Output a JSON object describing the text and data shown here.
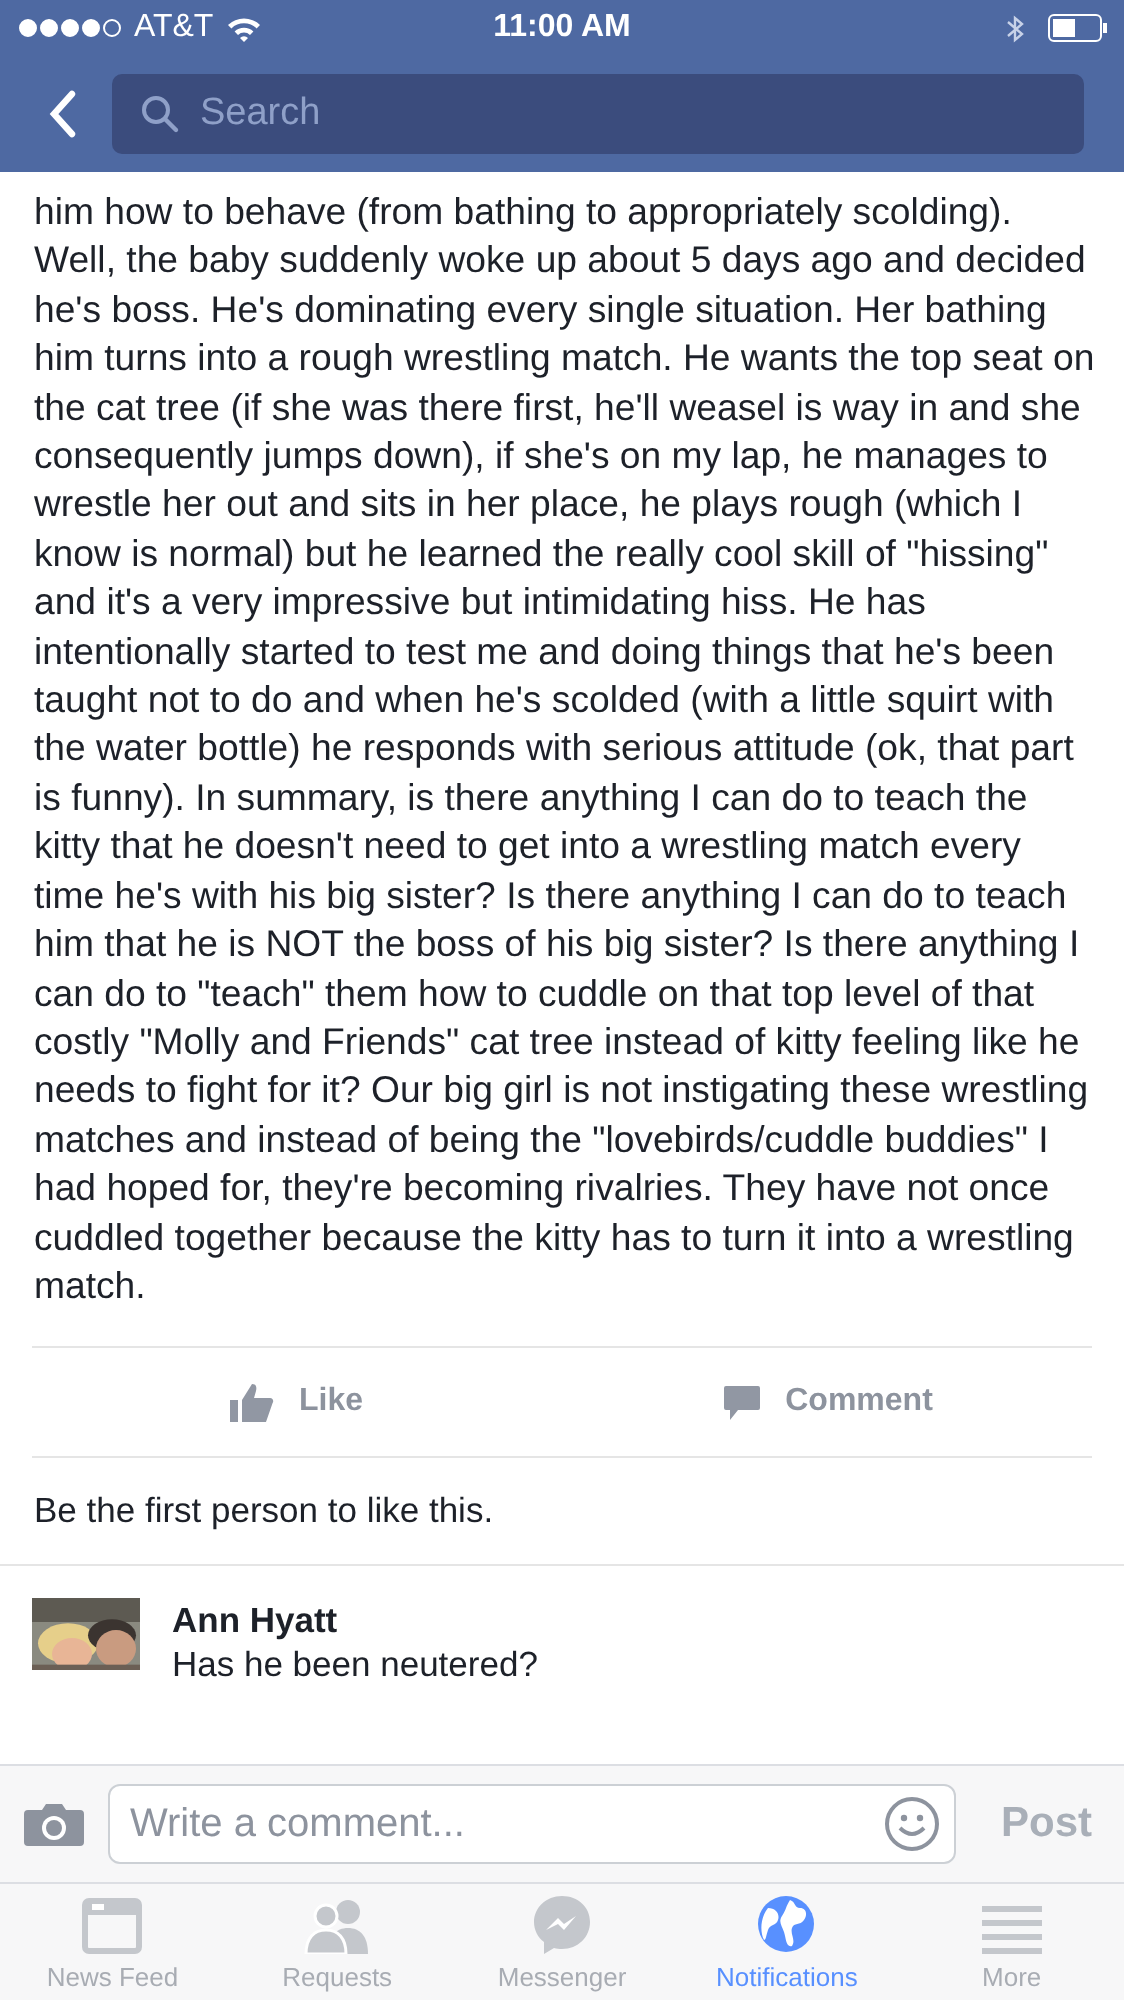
{
  "status_bar": {
    "carrier": "AT&T",
    "time": "11:00 AM"
  },
  "nav": {
    "search_placeholder": "Search"
  },
  "post": {
    "text": "him how to behave (from bathing to appropriately scolding). Well, the baby suddenly woke up about 5 days ago and decided he's boss. He's dominating every single situation. Her bathing him turns into a rough wrestling match. He wants the top seat on the cat tree (if she was there first, he'll weasel is way in and she consequently jumps down), if she's on my lap, he manages to wrestle her out and sits in her place, he plays rough (which I know is normal) but he learned the really cool skill of \"hissing\" and it's a very impressive but intimidating hiss. He has intentionally started to test me and doing things that he's been taught not to do and when he's scolded (with a little squirt with the water bottle) he responds with serious attitude (ok, that part is funny). In summary, is there anything I can do to teach the kitty that he doesn't need to get into a wrestling match every time he's with his big sister? Is there anything I can do to teach him that he is NOT the boss of his big sister? Is there anything I can do to \"teach\" them how to cuddle on that top level of that costly \"Molly and Friends\" cat tree instead of kitty feeling like he needs to fight for it? Our big girl is not instigating these wrestling matches and instead of being the \"lovebirds/cuddle buddies\" I had hoped for, they're becoming rivalries. They have not once cuddled together because the kitty has to turn it into a wrestling match.",
    "actions": [
      {
        "kind": "like",
        "label": "Like"
      },
      {
        "kind": "comment",
        "label": "Comment"
      }
    ],
    "likes_text": "Be the first person to like this."
  },
  "comments": [
    {
      "author": "Ann Hyatt",
      "text": "Has he been neutered?"
    }
  ],
  "composer": {
    "placeholder": "Write a comment...",
    "post_label": "Post"
  },
  "tabs": [
    {
      "kind": "feed",
      "label": "News Feed",
      "selected": false
    },
    {
      "kind": "requests",
      "label": "Requests",
      "selected": false
    },
    {
      "kind": "messenger",
      "label": "Messenger",
      "selected": false
    },
    {
      "kind": "notifications",
      "label": "Notifications",
      "selected": true
    },
    {
      "kind": "more",
      "label": "More",
      "selected": false
    }
  ]
}
